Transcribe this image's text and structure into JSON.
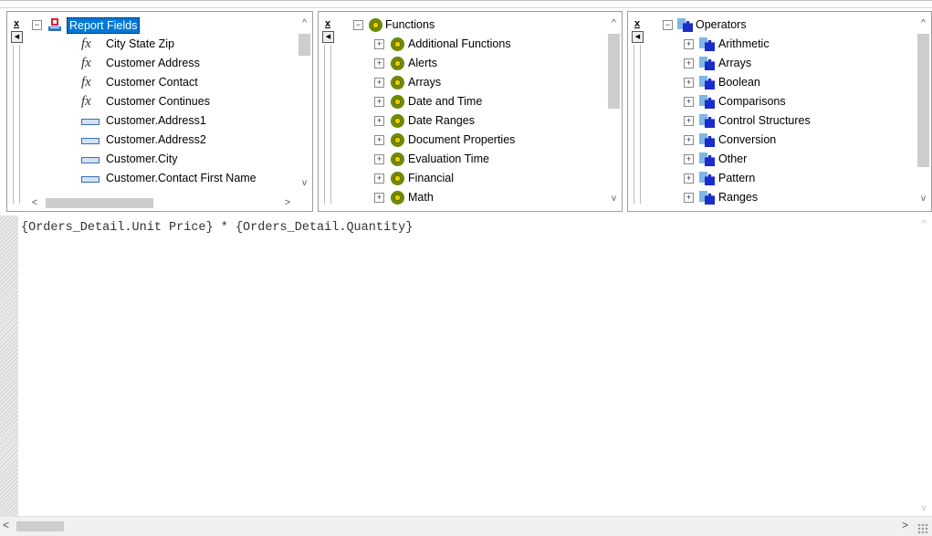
{
  "panels": {
    "fields": {
      "close_glyph": "x",
      "root": "Report Fields",
      "items": [
        {
          "label": "City State Zip",
          "icon": "formula-icon"
        },
        {
          "label": "Customer Address",
          "icon": "formula-icon"
        },
        {
          "label": "Customer Contact",
          "icon": "formula-icon"
        },
        {
          "label": "Customer Continues",
          "icon": "formula-icon"
        },
        {
          "label": "Customer.Address1",
          "icon": "database-field-icon"
        },
        {
          "label": "Customer.Address2",
          "icon": "database-field-icon"
        },
        {
          "label": "Customer.City",
          "icon": "database-field-icon"
        },
        {
          "label": "Customer.Contact First Name",
          "icon": "database-field-icon"
        }
      ]
    },
    "functions": {
      "close_glyph": "x",
      "root": "Functions",
      "items": [
        "Additional Functions",
        "Alerts",
        "Arrays",
        "Date and Time",
        "Date Ranges",
        "Document Properties",
        "Evaluation Time",
        "Financial",
        "Math"
      ]
    },
    "operators": {
      "close_glyph": "x",
      "root": "Operators",
      "items": [
        "Arithmetic",
        "Arrays",
        "Boolean",
        "Comparisons",
        "Control Structures",
        "Conversion",
        "Other",
        "Pattern",
        "Ranges"
      ]
    }
  },
  "editor": {
    "formula_text": "{Orders_Detail.Unit Price} * {Orders_Detail.Quantity}"
  },
  "glyphs": {
    "expand": "+",
    "collapse": "−",
    "up": "^",
    "down": "v",
    "left": "<",
    "right": ">",
    "fx": "fx"
  }
}
